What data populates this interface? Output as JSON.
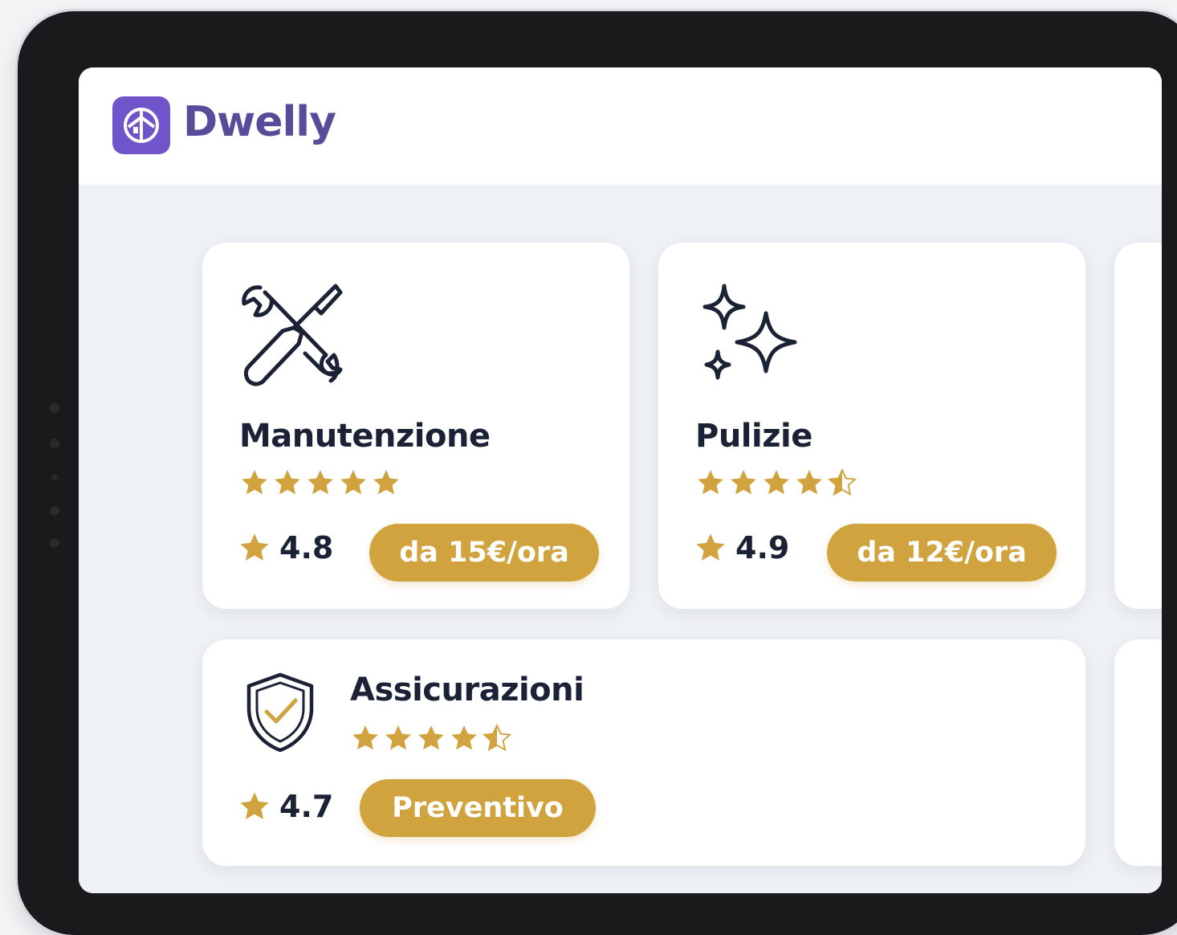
{
  "app": {
    "brand_name": "Dwelly",
    "brand_color": "#6f55c9",
    "logo_icon": "brand-logo-icon"
  },
  "services": [
    {
      "title": "Manutenzione",
      "icon": "tools-icon",
      "stars": 5,
      "rating": "4.8",
      "action_label": "da 15€/ora"
    },
    {
      "title": "Pulizie",
      "icon": "sparkles-icon",
      "stars": 4.5,
      "rating": "4.9",
      "action_label": "da 12€/ora"
    },
    {
      "title": "Assicurazioni",
      "icon": "shield-check-icon",
      "stars": 4.5,
      "rating": "4.7",
      "action_label": "Preventivo"
    }
  ],
  "colors": {
    "star": "#d0a33f",
    "button": "#d0a33f",
    "text": "#1b2235"
  }
}
